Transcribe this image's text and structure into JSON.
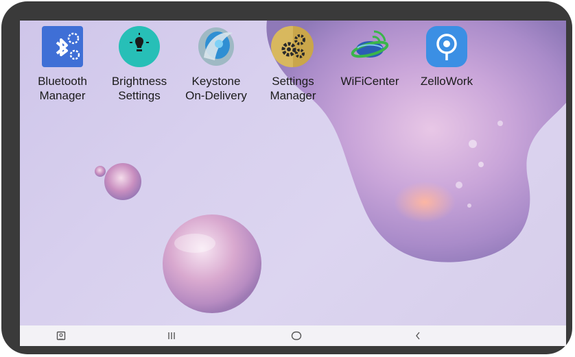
{
  "apps": [
    {
      "label": "Bluetooth\nManager",
      "icon": "bluetooth-gear-icon"
    },
    {
      "label": "Brightness\nSettings",
      "icon": "lightbulb-icon"
    },
    {
      "label": "Keystone\nOn-Delivery",
      "icon": "keystone-logo-icon"
    },
    {
      "label": "Settings\nManager",
      "icon": "gears-icon"
    },
    {
      "label": "WiFiCenter",
      "icon": "wifi-globe-icon"
    },
    {
      "label": "ZelloWork",
      "icon": "zello-pin-icon"
    }
  ],
  "navbar": {
    "icons": [
      "screenshot-icon",
      "recent-apps-icon",
      "home-icon",
      "back-icon"
    ]
  },
  "colors": {
    "bezel": "#3a3a3a",
    "navbar_bg": "#f3f2f6",
    "bluetooth_tile": "#3f6fd6",
    "brightness_tile": "#27bfb7",
    "settings_tile": "#caa64a",
    "zello_tile": "#3b8fe4"
  }
}
